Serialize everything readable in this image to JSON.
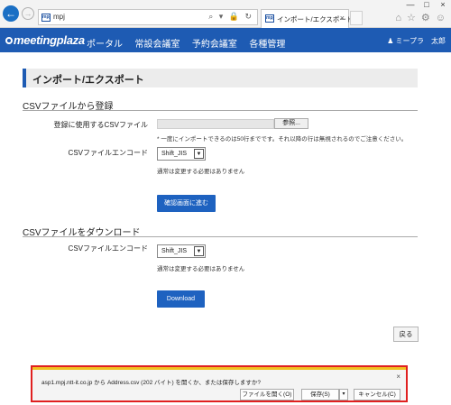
{
  "browser": {
    "address_text": "mpj",
    "favicon_text": "mpj",
    "tab_title": "インポート/エクスポート",
    "tab_close": "×",
    "back_symbol": "←",
    "forward_symbol": "→",
    "address_icons": "⌕ ▾ 🔒 ↻",
    "window_controls": [
      "—",
      "□",
      "×"
    ],
    "toolbar_icons": [
      "home-icon",
      "star-icon",
      "gear-icon",
      "smiley-icon"
    ],
    "toolbar_glyphs": [
      "⌂",
      "☆",
      "⚙",
      "☺"
    ]
  },
  "app": {
    "logo": "meetingplaza",
    "nav": [
      "ポータル",
      "常設会議室",
      "予約会議室",
      "各種管理"
    ],
    "user_label": "ミープラ　太郎",
    "user_icon": "user-icon"
  },
  "page": {
    "title": "インポート/エクスポート",
    "import": {
      "section_title": "CSVファイルから登録",
      "file_label": "登録に使用するCSVファイル",
      "browse_label": "参照...",
      "file_note": "* 一度にインポートできるのは50行までです。それ以降の行は無視されるのでご注意ください。",
      "encoding_label": "CSVファイルエンコード",
      "encoding_value": "Shift_JIS",
      "encoding_note": "通常は変更する必要はありません",
      "confirm_label": "確認画面に進む"
    },
    "download": {
      "section_title": "CSVファイルをダウンロード",
      "encoding_label": "CSVファイルエンコード",
      "encoding_value": "Shift_JIS",
      "encoding_note": "通常は変更する必要はありません",
      "download_label": "Download"
    },
    "back_label": "戻る"
  },
  "download_bar": {
    "message": "asp1.mpj.ntt-it.co.jp から Address.csv (202 バイト) を開くか、または保存しますか?",
    "open_label": "ファイルを開く(O)",
    "save_label": "保存(S)",
    "dropdown_symbol": "▾",
    "cancel_label": "キャンセル(C)",
    "close_symbol": "×"
  }
}
